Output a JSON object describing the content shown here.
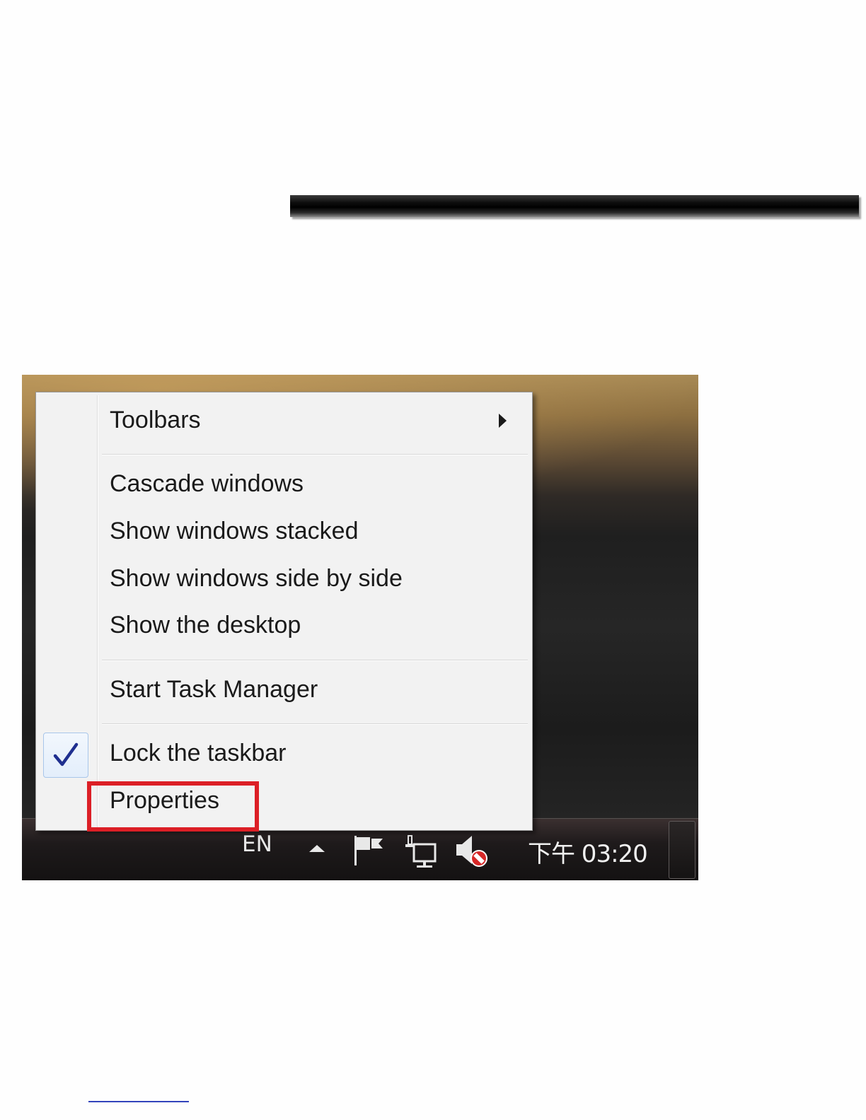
{
  "context_menu": {
    "items": [
      {
        "label": "Toolbars",
        "has_submenu": true
      },
      {
        "label": "Cascade windows"
      },
      {
        "label": "Show windows stacked"
      },
      {
        "label": "Show windows side by side"
      },
      {
        "label": "Show the desktop"
      },
      {
        "label": "Start Task Manager"
      },
      {
        "label": "Lock the taskbar",
        "checked": true
      },
      {
        "label": "Properties",
        "highlighted": true
      }
    ]
  },
  "taskbar": {
    "language": "EN",
    "clock": "下午 03:20",
    "tray_icons": [
      "show-hidden-icons-arrow",
      "action-center-flag-icon",
      "network-icon",
      "volume-muted-icon"
    ]
  },
  "colors": {
    "highlight_border": "#dc1f26",
    "check_mark": "#1f2f8f",
    "menu_background": "#f2f2f2"
  }
}
